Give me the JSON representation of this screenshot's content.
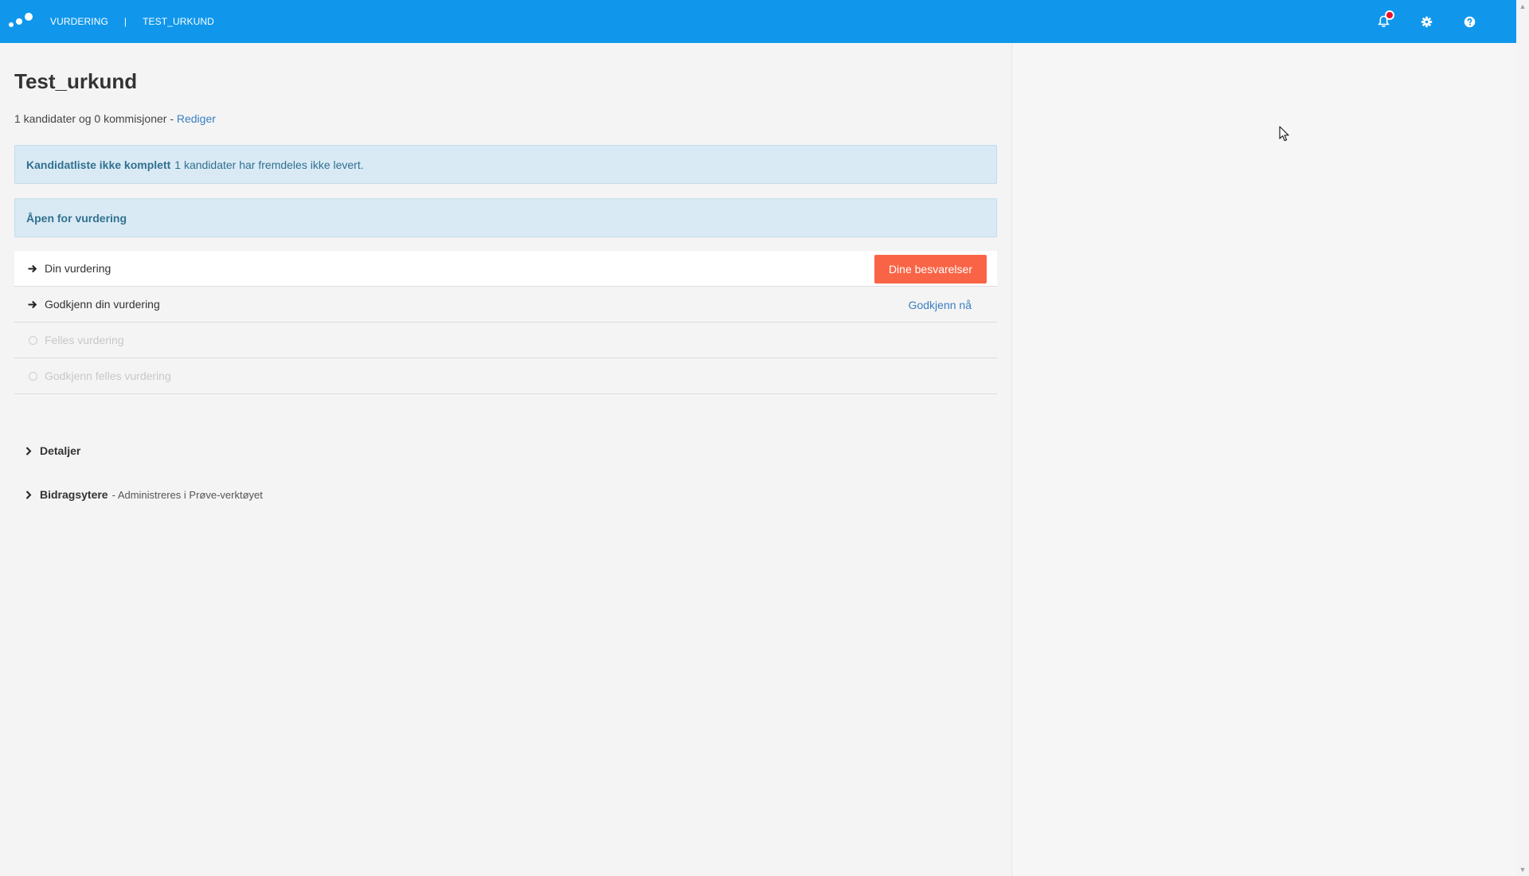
{
  "header": {
    "breadcrumb": [
      "VURDERING",
      "TEST_URKUND"
    ],
    "separator": "|",
    "icons": [
      "bell-icon",
      "gear-icon",
      "help-icon"
    ],
    "colors": {
      "bar": "#1097ec",
      "notification": "#e8102b"
    }
  },
  "page": {
    "title": "Test_urkund",
    "subtitle_text": "1 kandidater og 0 kommisjoner - ",
    "edit_link": "Rediger"
  },
  "alerts": [
    {
      "title": "Kandidatliste ikke komplett",
      "text": "1 kandidater har fremdeles ikke levert."
    },
    {
      "title": "Åpen for vurdering",
      "text": ""
    }
  ],
  "steps": [
    {
      "label": "Din vurdering",
      "state": "active",
      "action_label": "Dine besvarelser"
    },
    {
      "label": "Godkjenn din vurdering",
      "state": "pending",
      "action_label": "Godkjenn nå"
    },
    {
      "label": "Felles vurdering",
      "state": "disabled"
    },
    {
      "label": "Godkjenn felles vurdering",
      "state": "disabled"
    }
  ],
  "sections": [
    {
      "title": "Detaljer",
      "note": ""
    },
    {
      "title": "Bidragsytere",
      "note": "- Administreres i Prøve-verktøyet"
    }
  ],
  "colors": {
    "primary_button": "#fa6446",
    "link": "#3a7fc1",
    "alert_bg": "#d9eaf5"
  }
}
